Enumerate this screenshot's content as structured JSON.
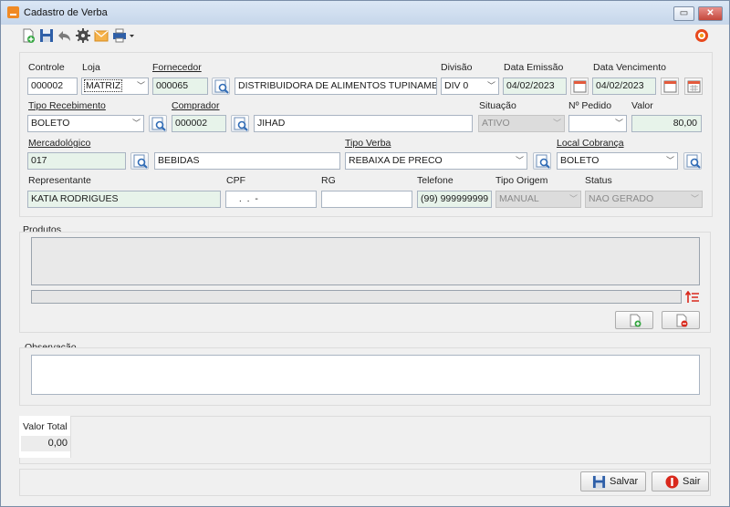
{
  "window": {
    "title": "Cadastro de Verba",
    "minimize_label": "▭",
    "close_label": "✕"
  },
  "header": {
    "controle": {
      "label": "Controle",
      "value": "000002"
    },
    "loja": {
      "label": "Loja",
      "value": "MATRIZ"
    },
    "fornecedor": {
      "label": "Fornecedor",
      "code": "000065",
      "name": "DISTRIBUIDORA DE ALIMENTOS TUPINAMBA"
    },
    "divisao": {
      "label": "Divisão",
      "value": "DIV 0"
    },
    "data_emissao": {
      "label": "Data Emissão",
      "value": "04/02/2023"
    },
    "data_vencimento": {
      "label": "Data Vencimento",
      "value": "04/02/2023"
    },
    "tipo_recebimento": {
      "label": "Tipo Recebimento",
      "value": "BOLETO"
    },
    "comprador": {
      "label": "Comprador",
      "code": "000002",
      "name": "JIHAD"
    },
    "situacao": {
      "label": "Situação",
      "value": "ATIVO"
    },
    "num_pedido": {
      "label": "Nº Pedido",
      "value": ""
    },
    "valor": {
      "label": "Valor",
      "value": "80,00"
    },
    "mercadologico": {
      "label": "Mercadológico",
      "code": "017",
      "name": "BEBIDAS"
    },
    "tipo_verba": {
      "label": "Tipo Verba",
      "value": "REBAIXA DE PRECO"
    },
    "local_cobranca": {
      "label": "Local Cobrança",
      "value": "BOLETO"
    },
    "representante": {
      "label": "Representante",
      "value": "KATIA RODRIGUES"
    },
    "cpf": {
      "label": "CPF",
      "value": "  .  .  -"
    },
    "rg": {
      "label": "RG",
      "value": ""
    },
    "telefone": {
      "label": "Telefone",
      "value": "(99) 999999999"
    },
    "tipo_origem": {
      "label": "Tipo Origem",
      "value": "MANUAL"
    },
    "status": {
      "label": "Status",
      "value": "NAO GERADO"
    }
  },
  "produtos": {
    "label": "Produtos"
  },
  "observacao": {
    "label": "Observação",
    "value": ""
  },
  "total": {
    "label": "Valor Total",
    "value": "0,00"
  },
  "actions": {
    "save_label": "Salvar",
    "exit_label": "Sair"
  },
  "colors": {
    "field_green": "#e7f3ea",
    "accent_orange": "#f08a24",
    "exit_red": "#d9281c"
  }
}
